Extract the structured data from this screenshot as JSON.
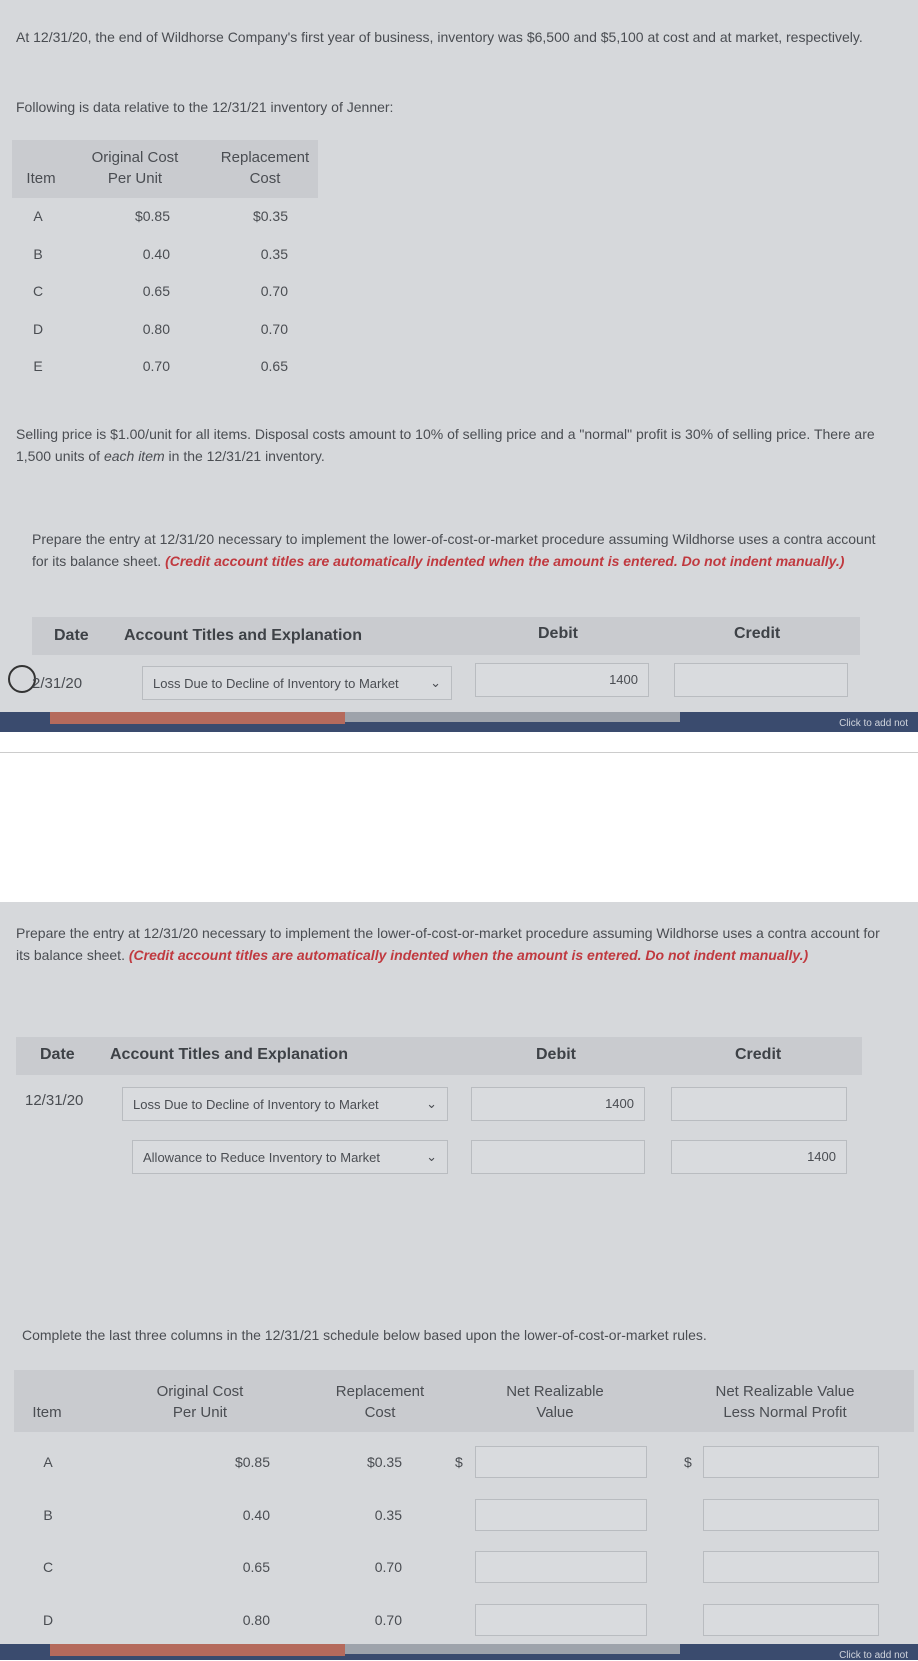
{
  "intro": {
    "line": "At 12/31/20, the end of Wildhorse Company's first year of business, inventory was $6,500 and $5,100 at cost and at market, respectively.",
    "following": "Following is data relative to the 12/31/21 inventory of Jenner:"
  },
  "table1": {
    "headers": {
      "item": "Item",
      "cost1": "Original Cost",
      "cost2": "Per Unit",
      "rep1": "Replacement",
      "rep2": "Cost"
    },
    "rows": [
      {
        "item": "A",
        "cost": "$0.85",
        "rep": "$0.35"
      },
      {
        "item": "B",
        "cost": "0.40",
        "rep": "0.35"
      },
      {
        "item": "C",
        "cost": "0.65",
        "rep": "0.70"
      },
      {
        "item": "D",
        "cost": "0.80",
        "rep": "0.70"
      },
      {
        "item": "E",
        "cost": "0.70",
        "rep": "0.65"
      }
    ]
  },
  "selling": "Selling price is $1.00/unit for all items. Disposal costs amount to 10% of selling price and a \"normal\" profit is 30% of selling price. There are 1,500 units of",
  "selling_em": "each item",
  "selling_end": "in the 12/31/21 inventory.",
  "prepare": {
    "text": "Prepare the entry at 12/31/20 necessary to implement the lower-of-cost-or-market procedure assuming Wildhorse uses a contra account for its balance sheet.",
    "note": "(Credit account titles are automatically indented when the amount is entered. Do not indent manually.)"
  },
  "journal": {
    "headers": {
      "date": "Date",
      "account": "Account Titles and Explanation",
      "debit": "Debit",
      "credit": "Credit"
    },
    "rows": [
      {
        "date": "12/31/20",
        "account": "Loss Due to Decline of Inventory to Market",
        "debit": "1400",
        "credit": ""
      },
      {
        "date": "",
        "account": "Allowance to Reduce Inventory to Market",
        "debit": "",
        "credit": "1400"
      }
    ]
  },
  "journal_partial_date": "2/31/20",
  "strip_text": "Click to add not",
  "complete": "Complete the last three columns in the 12/31/21 schedule below based upon the lower-of-cost-or-market rules.",
  "table2": {
    "headers": {
      "item": "Item",
      "cost1": "Original Cost",
      "cost2": "Per Unit",
      "rep1": "Replacement",
      "rep2": "Cost",
      "nrv1": "Net Realizable",
      "nrv2": "Value",
      "nrvp1": "Net Realizable Value",
      "nrvp2": "Less Normal Profit"
    },
    "currency": "$",
    "rows": [
      {
        "item": "A",
        "cost": "$0.85",
        "rep": "$0.35"
      },
      {
        "item": "B",
        "cost": "0.40",
        "rep": "0.35"
      },
      {
        "item": "C",
        "cost": "0.65",
        "rep": "0.70"
      },
      {
        "item": "D",
        "cost": "0.80",
        "rep": "0.70"
      }
    ]
  }
}
